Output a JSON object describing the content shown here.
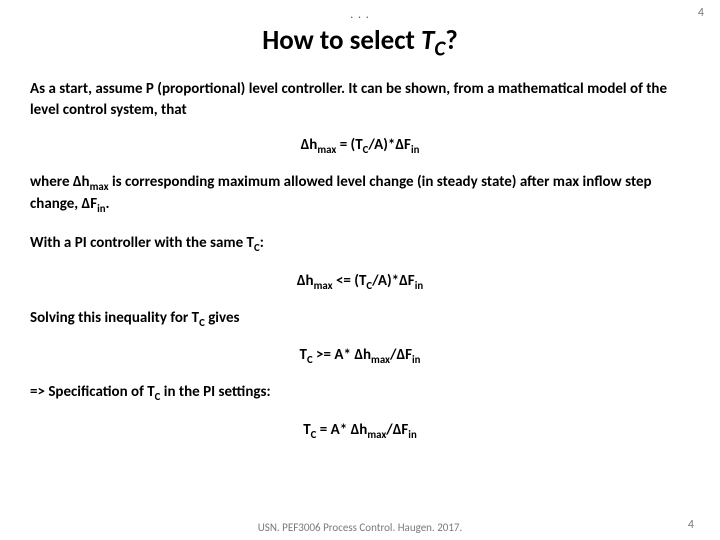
{
  "page_number_top": "4",
  "dots": ". . .",
  "title_plain": "How to select ",
  "title_var": "T",
  "title_var_sub": "C",
  "title_q": "?",
  "para1": "As a start, assume P (proportional) level controller. It can be shown, from a mathematical model of the level control system, that",
  "eq1_lhs_var": "Δh",
  "eq1_lhs_sub": "max",
  "eq1_eq": " = (T",
  "eq1_tcsub": "C",
  "eq1_mid": "/A)*ΔF",
  "eq1_finsub": "in",
  "para2_a": "where Δh",
  "para2_a_sub": "max",
  "para2_b": " is corresponding maximum allowed level change (in steady state) after max inflow step change, ΔF",
  "para2_b_sub": "in",
  "para2_c": ".",
  "para3_a": "With a PI controller with the same T",
  "para3_a_sub": "C",
  "para3_b": ":",
  "eq2_lhs_var": "Δh",
  "eq2_lhs_sub": "max",
  "eq2_op": " <= (T",
  "eq2_tcsub": "C",
  "eq2_mid": "/A)*ΔF",
  "eq2_finsub": "in",
  "para4_a": "Solving this inequality for T",
  "para4_a_sub": "C",
  "para4_b": " gives",
  "eq3_lhs": "T",
  "eq3_lhs_sub": "C",
  "eq3_op": " >= A* Δh",
  "eq3_hsub": "max",
  "eq3_mid": "/ΔF",
  "eq3_finsub": "in",
  "para5_a": "=> Specification of T",
  "para5_a_sub": "C",
  "para5_b": " in the PI settings:",
  "eq4_lhs": "T",
  "eq4_lhs_sub": "C",
  "eq4_op": " = A* Δh",
  "eq4_hsub": "max",
  "eq4_mid": "/ΔF",
  "eq4_finsub": "in",
  "footer": "USN. PEF3006 Process Control. Haugen. 2017.",
  "page_number_bottom": "4"
}
